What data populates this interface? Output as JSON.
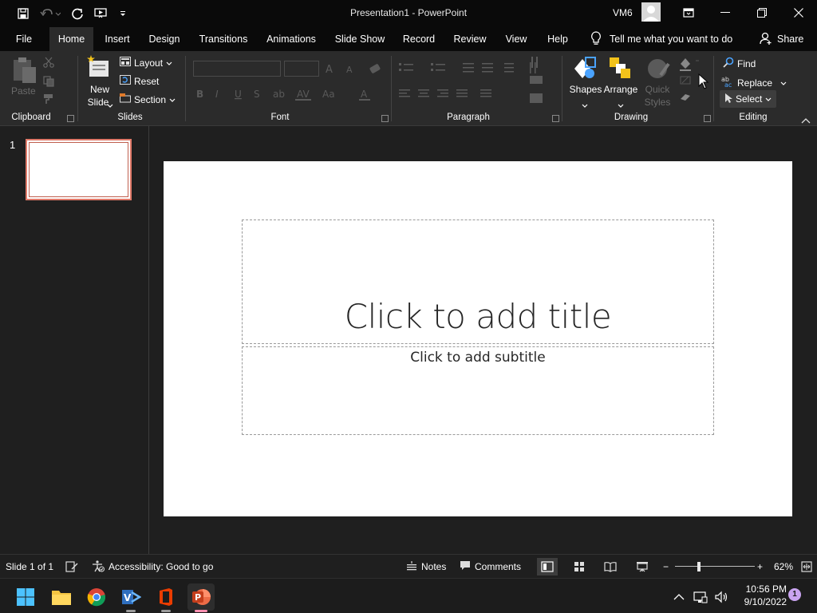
{
  "window": {
    "title": "Presentation1  -  PowerPoint",
    "user": "VM6"
  },
  "tabs": [
    {
      "label": "File"
    },
    {
      "label": "Home"
    },
    {
      "label": "Insert"
    },
    {
      "label": "Design"
    },
    {
      "label": "Transitions"
    },
    {
      "label": "Animations"
    },
    {
      "label": "Slide Show"
    },
    {
      "label": "Record"
    },
    {
      "label": "Review"
    },
    {
      "label": "View"
    },
    {
      "label": "Help"
    }
  ],
  "tellme": {
    "text": "Tell me what you want to do"
  },
  "share": {
    "label": "Share"
  },
  "ribbon": {
    "clipboard": {
      "label": "Clipboard",
      "paste": "Paste"
    },
    "slides": {
      "label": "Slides",
      "new_slide_1": "New",
      "new_slide_2": "Slide",
      "layout": "Layout",
      "reset": "Reset",
      "section": "Section"
    },
    "font": {
      "label": "Font"
    },
    "paragraph": {
      "label": "Paragraph"
    },
    "drawing": {
      "label": "Drawing",
      "shapes": "Shapes",
      "arrange": "Arrange",
      "quick_styles_1": "Quick",
      "quick_styles_2": "Styles"
    },
    "editing": {
      "label": "Editing",
      "find": "Find",
      "replace": "Replace",
      "select": "Select"
    }
  },
  "thumbnails": {
    "number": "1"
  },
  "slide": {
    "title_placeholder": "Click to add title",
    "subtitle_placeholder": "Click to add subtitle"
  },
  "status": {
    "slide_info": "Slide 1 of 1",
    "accessibility": "Accessibility: Good to go",
    "notes": "Notes",
    "comments": "Comments",
    "zoom_minus": "−",
    "zoom_plus": "+",
    "zoom": "62%",
    "zoom_level": 0.3
  },
  "taskbar": {
    "time": "10:56 PM",
    "date": "9/10/2022",
    "notifications": "1"
  },
  "colors": {
    "accent_powerpoint": "#c43e1c",
    "thumb_border": "#e07a6a",
    "ribbon_bg": "#2b2b2b",
    "titlebar_bg": "#0a0a0a"
  }
}
